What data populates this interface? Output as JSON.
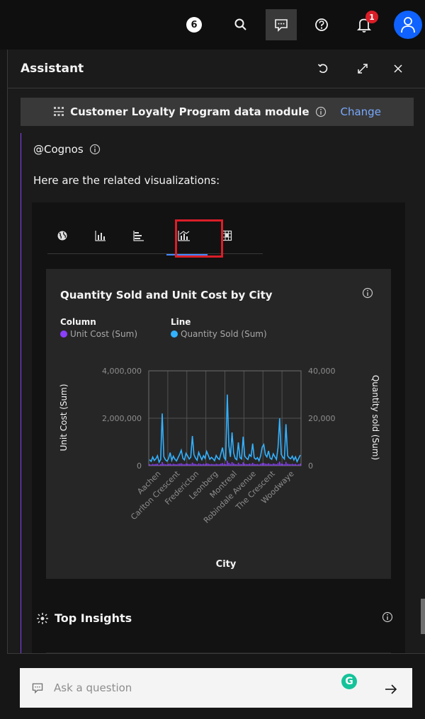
{
  "topbar": {
    "badge_count": "6",
    "notification_count": "1"
  },
  "assistant": {
    "title": "Assistant",
    "module": {
      "name": "Customer Loyalty Program data module",
      "change_label": "Change"
    },
    "sender": "@Cognos",
    "message": "Here are the related visualizations:",
    "viz_tabs": [
      "map-icon",
      "column-chart-icon",
      "bar-chart-icon",
      "combo-chart-icon",
      "heatmap-icon"
    ],
    "selected_tab": 3,
    "insights_title": "Top Insights",
    "input_placeholder": "Ask a question"
  },
  "chart_data": {
    "type": "bar",
    "title": "Quantity Sold and Unit Cost by City",
    "xlabel": "City",
    "ylabel": "Unit Cost (Sum)",
    "y2label": "Quantity sold (Sum)",
    "legend": {
      "column_header": "Column",
      "line_header": "Line",
      "column_series": "Unit Cost (Sum)",
      "line_series": "Quantity Sold (Sum)"
    },
    "ylim": [
      0,
      4000000
    ],
    "y2lim": [
      0,
      40000
    ],
    "yticks": [
      "4,000,000",
      "2,000,000",
      "0"
    ],
    "y2ticks": [
      "40,000",
      "20,000",
      "0"
    ],
    "categories": [
      "Aachen",
      "Carlton Crescent",
      "Fredericton",
      "Leonberg",
      "Montreal",
      "Robindale Avenue",
      "The Crescent",
      "Woodwaye"
    ],
    "series": [
      {
        "name": "Quantity Sold (Sum)",
        "axis": "right",
        "values": [
          2500,
          1800,
          3600,
          2200,
          2900,
          4200,
          1500,
          2600,
          22000,
          3800,
          2500,
          1900,
          3000,
          5500,
          2200,
          4000,
          2700,
          2000,
          3400,
          4800,
          6500,
          3100,
          2400,
          5200,
          4100,
          2800,
          3600,
          12500,
          4700,
          3200,
          2300,
          5600,
          3900,
          2500,
          4200,
          3100,
          6000,
          4400,
          2700,
          3500,
          2900,
          2100,
          4300,
          3200,
          2600,
          5100,
          7600,
          3400,
          2500,
          30000,
          8400,
          3700,
          14000,
          5400,
          3000,
          2500,
          9800,
          3400,
          2800,
          12200,
          4100,
          3200,
          2600,
          4700,
          3900,
          9300,
          3300,
          2700,
          3400,
          2100,
          4100,
          7800,
          8900,
          4700,
          3700,
          6200,
          3200,
          2700,
          5000,
          3800,
          2600,
          7600,
          20000,
          4800,
          3600,
          2800,
          17500,
          4200,
          3300,
          2900,
          4000,
          2400,
          3700,
          1700,
          3000,
          4500
        ]
      },
      {
        "name": "Unit Cost (Sum)",
        "axis": "left",
        "values": [
          60000,
          48000,
          72000,
          55000,
          70000,
          80000,
          42000,
          66000,
          150000,
          76000,
          60000,
          50000,
          72000,
          90000,
          54000,
          80000,
          64000,
          52000,
          76000,
          86000,
          100000,
          70000,
          58000,
          90000,
          80000,
          64000,
          74000,
          130000,
          84000,
          70000,
          56000,
          94000,
          76000,
          60000,
          80000,
          68000,
          100000,
          82000,
          62000,
          72000,
          64000,
          52000,
          82000,
          68000,
          60000,
          90000,
          110000,
          70000,
          58000,
          200000,
          120000,
          74000,
          150000,
          96000,
          66000,
          58000,
          124000,
          70000,
          62000,
          140000,
          80000,
          68000,
          60000,
          86000,
          76000,
          120000,
          70000,
          62000,
          72000,
          52000,
          80000,
          106000,
          114000,
          86000,
          74000,
          100000,
          70000,
          62000,
          90000,
          76000,
          60000,
          106000,
          170000,
          86000,
          72000,
          62000,
          160000,
          80000,
          70000,
          64000,
          78000,
          56000,
          74000,
          46000,
          66000,
          84000
        ]
      }
    ]
  }
}
